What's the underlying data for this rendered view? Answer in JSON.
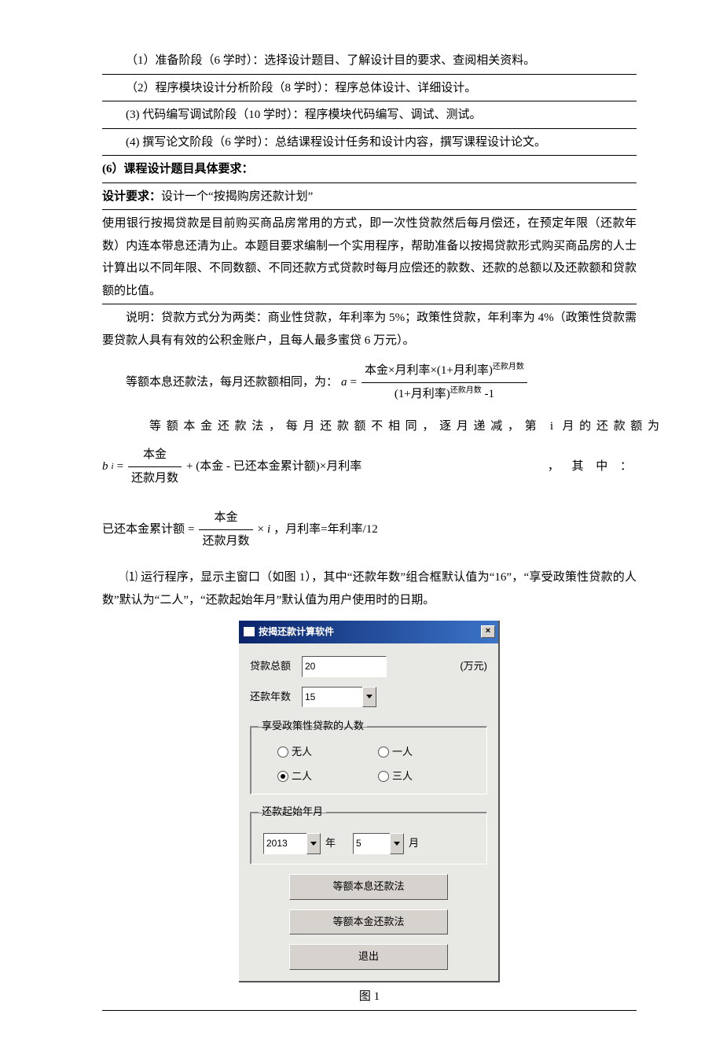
{
  "steps": {
    "s1": "（1）准备阶段（6 学时）：选择设计题目、了解设计目的要求、查阅相关资料。",
    "s2": "（2）程序模块设计分析阶段（8 学时）：程序总体设计、详细设计。",
    "s3": "(3) 代码编写调试阶段（10 学时）：程序模块代码编写、调试、测试。",
    "s4": "(4) 撰写论文阶段（6 学时）：总结课程设计任务和设计内容，撰写课程设计论文。"
  },
  "section6": "(6）课程设计题目具体要求：",
  "req_label": "设计要求：",
  "req_text": "设计一个“按揭购房还款计划”",
  "para1": "使用银行按揭贷款是目前购买商品房常用的方式，即一次性贷款然后每月偿还，在预定年限（还款年数）内连本带息还清为止。本题目要求编制一个实用程序，帮助准备以按揭贷款形式购买商品房的人士计算出以不同年限、不同数额、不同还款方式贷款时每月应偿还的款数、还款的总额以及还款额和贷款额的比值。",
  "para2": "说明：贷款方式分为两类：商业性贷款，年利率为 5%；政策性贷款，年利率为 4%（政策性贷款需要贷款人具有有效的公积金账户，且每人最多蜜贷 6 万元）。",
  "eq1_lead": "等额本息还款法，每月还款额相同，为：",
  "eq1_a": "a",
  "eq1_eq": "=",
  "eq1_num": "本金×月利率×(1+月利率)",
  "eq1_exp": "还款月数",
  "eq1_den_l": "(1+月利率)",
  "eq1_den_r": " -1",
  "eq2_lead": "等额本金还款法，每月还款额不相同，逐月递减，第 i 月的还款额为",
  "eq2_b": "b",
  "eq2_i": "i",
  "eq2_frac_num": "本金",
  "eq2_frac_den": "还款月数",
  "eq2_rest": "+ (本金 - 已还本金累计额)×月利率",
  "eq2_tail": "，      其       中      ：",
  "eq3_lhs": "已还本金累计额",
  "eq3_num": "本金",
  "eq3_den": "还款月数",
  "eq3_xi": "× ",
  "eq3_i": "i",
  "eq3_tail": "    ，月利率=年利率/12",
  "run_desc": "⑴ 运行程序，显示主窗口（如图 1），其中“还款年数”组合框默认值为“16”，“享受政策性贷款的人数”默认为“二人”，“还款起始年月”默认值为用户使用时的日期。",
  "app": {
    "title": "按揭还款计算软件",
    "close": "×",
    "loan_label": "贷款总额",
    "loan_value": "20",
    "loan_unit": "(万元)",
    "years_label": "还款年数",
    "years_value": "15",
    "group_people": "享受政策性贷款的人数",
    "r_none": "无人",
    "r_one": "一人",
    "r_two": "二人",
    "r_three": "三人",
    "group_date": "还款起始年月",
    "year_value": "2013",
    "year_unit": "年",
    "month_value": "5",
    "month_unit": "月",
    "btn1": "等额本息还款法",
    "btn2": "等额本金还款法",
    "btn3": "退出"
  },
  "fig_caption": "图 1"
}
